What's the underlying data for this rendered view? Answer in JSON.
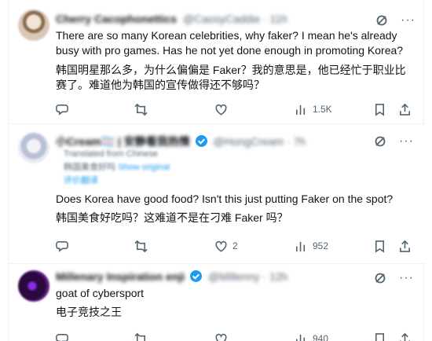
{
  "posts": [
    {
      "author_name": "Cherry Cacophonettics",
      "author_handle": "@CaosyCaddie · 11h",
      "text_en": "There are so many Korean celebrities, why faker? I mean he's already busy with pro games. Has he not yet done enough in promoting Korea?",
      "text_zh": "韩国明星那么多，为什么偏偏是 Faker？我的意思是，他已经忙于职业比赛了。难道他为韩国的宣传做得还不够吗？",
      "likes": "",
      "views": "1.5K"
    },
    {
      "author_name": "小Cream🏳️‍⚧️ | 安静看我热情",
      "author_handle": "@HongCream · 7h",
      "translated_from": "Translated from Chinese",
      "show_original": "Show original",
      "translated_line": "韩国美食好吗",
      "rate_label": "评价翻译",
      "text_en": "Does Korea have good food? Isn't this just putting Faker on the spot?",
      "text_zh": "韩国美食好吃吗？这难道不是在刁难 Faker 吗？",
      "likes": "2",
      "views": "952"
    },
    {
      "author_name": "Millenary Inspiration enji",
      "author_handle": "@Millenny · 12h",
      "text_en": "goat of cybersport",
      "text_zh": "电子竞技之王",
      "likes": "",
      "views": "940"
    }
  ],
  "icons": {
    "grok": "grok-icon",
    "more": "more-icon",
    "reply": "reply-icon",
    "retweet": "retweet-icon",
    "like": "like-icon",
    "views": "views-icon",
    "bookmark": "bookmark-icon",
    "share": "share-icon"
  },
  "colors": {
    "text": "#0f1419",
    "muted": "#536471",
    "accent": "#1d9bf0",
    "border": "#eff3f4"
  }
}
